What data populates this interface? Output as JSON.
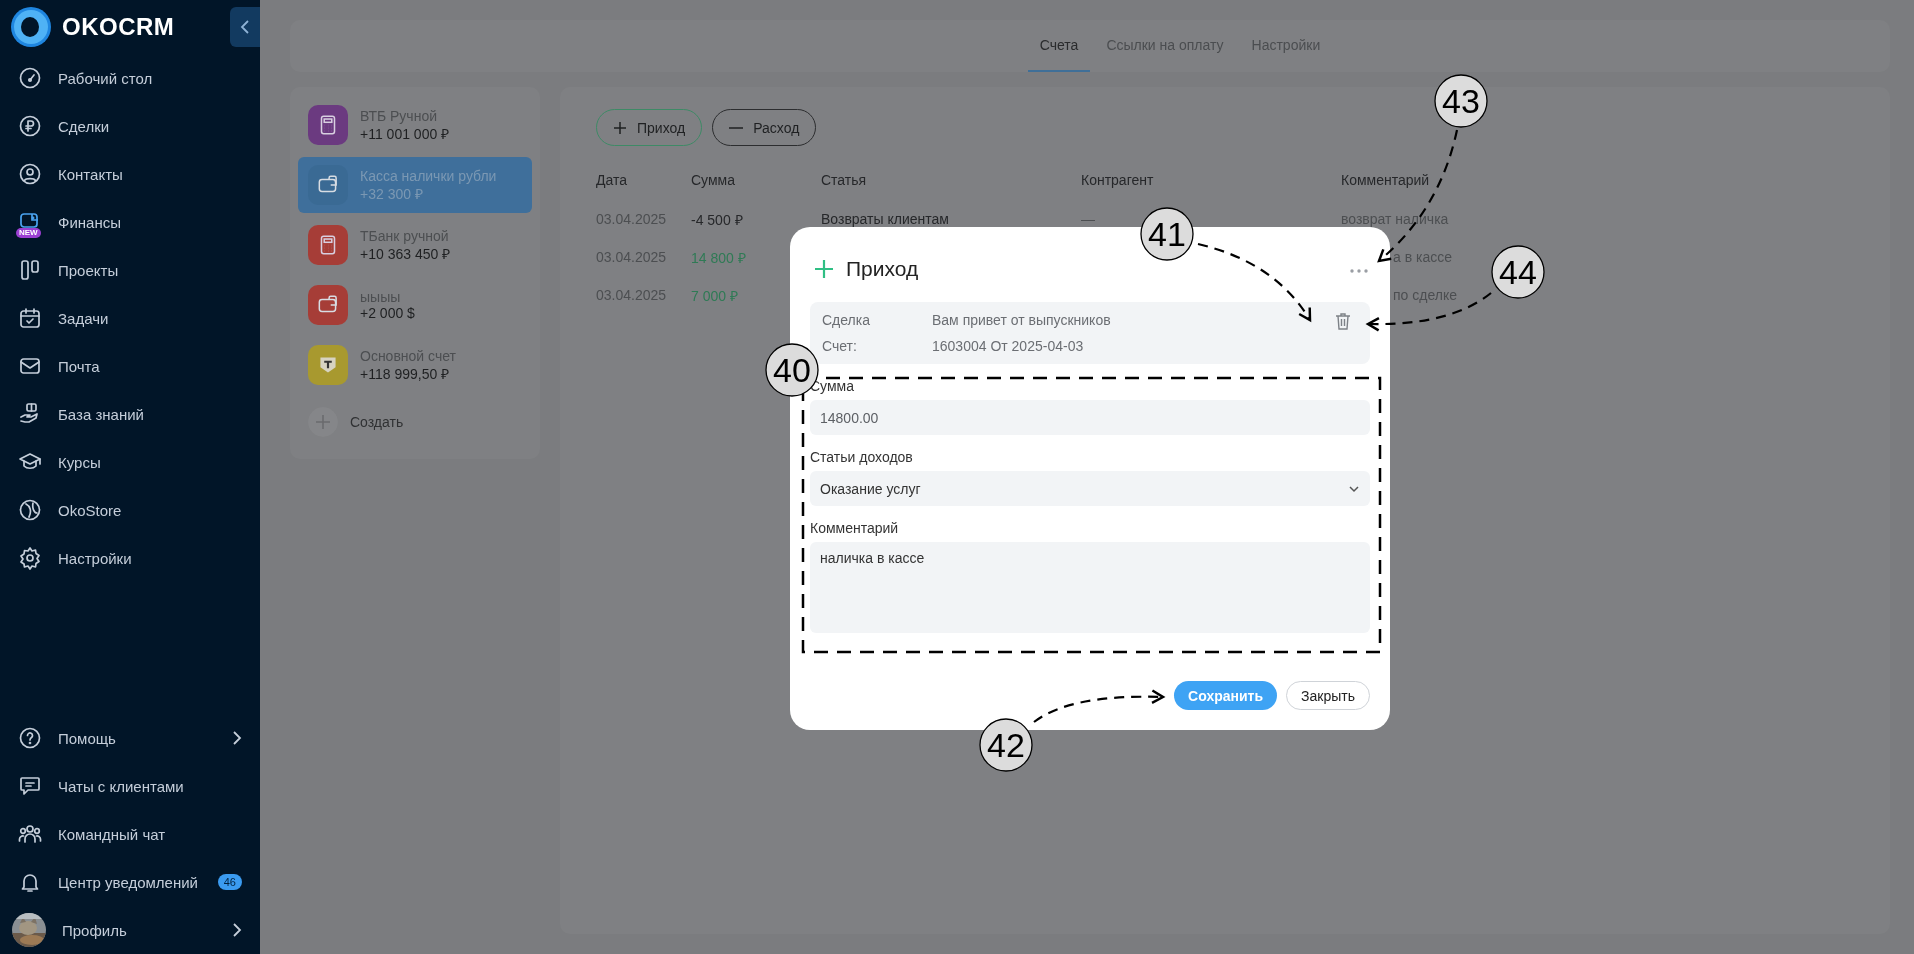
{
  "sidebar": {
    "logo": "OKOCRM",
    "items": [
      {
        "label": "Рабочий стол"
      },
      {
        "label": "Сделки"
      },
      {
        "label": "Контакты"
      },
      {
        "label": "Финансы",
        "badge": "NEW"
      },
      {
        "label": "Проекты"
      },
      {
        "label": "Задачи"
      },
      {
        "label": "Почта"
      },
      {
        "label": "База знаний"
      },
      {
        "label": "Курсы"
      },
      {
        "label": "OkoStore"
      },
      {
        "label": "Настройки"
      }
    ],
    "bottom_items": [
      {
        "label": "Помощь",
        "expandable": true
      },
      {
        "label": "Чаты с клиентами",
        "expandable": false
      },
      {
        "label": "Командный чат",
        "expandable": false
      },
      {
        "label": "Центр уведомлений",
        "count": "46",
        "expandable": false
      },
      {
        "label": "Профиль",
        "expandable": true
      }
    ]
  },
  "tabs": [
    {
      "label": "Счета",
      "selected": true
    },
    {
      "label": "Ссылки на оплату",
      "selected": false
    },
    {
      "label": "Настройки",
      "selected": false
    }
  ],
  "accounts": [
    {
      "name": "ВТБ Ручной",
      "balance": "+11 001 000 ₽",
      "color": "#6b3a80",
      "selected": false
    },
    {
      "name": "Касса налички рубли",
      "balance": "+32 300 ₽",
      "color": "#3a6a94",
      "selected": true
    },
    {
      "name": "ТБанк ручной",
      "balance": "+10 363 450 ₽",
      "color": "#a63d37",
      "selected": false
    },
    {
      "name": "ыыыы",
      "balance": "+2 000 $",
      "color": "#a63d37",
      "selected": false
    },
    {
      "name": "Основной счет",
      "balance": "+118 999,50 ₽",
      "color": "#a8992f",
      "selected": false
    }
  ],
  "create_label": "Создать",
  "actions": [
    {
      "label": "Приход",
      "kind": "income"
    },
    {
      "label": "Расход",
      "kind": "expense"
    }
  ],
  "table": {
    "columns": [
      "Дата",
      "Сумма",
      "Статья",
      "Контрагент",
      "Комментарий"
    ],
    "rows": [
      {
        "date": "03.04.2025",
        "amount": "-4 500 ₽",
        "income": false,
        "category": "Возвраты клиентам",
        "counterparty": "—",
        "comment": "возврат наличка",
        "comment_clipped": false
      },
      {
        "date": "03.04.2025",
        "amount": "14 800 ₽",
        "income": true,
        "comment": "а в кассе",
        "comment_clipped": true
      },
      {
        "date": "03.04.2025",
        "amount": "7 000 ₽",
        "income": true,
        "comment": "по сделке",
        "comment_clipped": true
      }
    ]
  },
  "dialog": {
    "title": "Приход",
    "info": [
      {
        "label": "Сделка",
        "value": "Вам привет от выпускников"
      },
      {
        "label": "Счет:",
        "value": "1603004 От 2025-04-03"
      }
    ],
    "fields": [
      {
        "kind": "input",
        "label": "Сумма",
        "value": "14800.00"
      },
      {
        "kind": "select",
        "label": "Статьи доходов",
        "value": "Оказание услуг"
      },
      {
        "kind": "textarea",
        "label": "Комментарий",
        "value": "наличка в кассе"
      }
    ],
    "buttons": [
      {
        "label": "Сохранить",
        "kind": "primary"
      },
      {
        "label": "Закрыть",
        "kind": "secondary"
      }
    ]
  },
  "annotations": [
    {
      "label": "40",
      "kind": "frame"
    },
    {
      "label": "41",
      "kind": "arrow"
    },
    {
      "label": "42",
      "kind": "arrow"
    },
    {
      "label": "43",
      "kind": "arrow"
    },
    {
      "label": "44",
      "kind": "arrow"
    }
  ]
}
